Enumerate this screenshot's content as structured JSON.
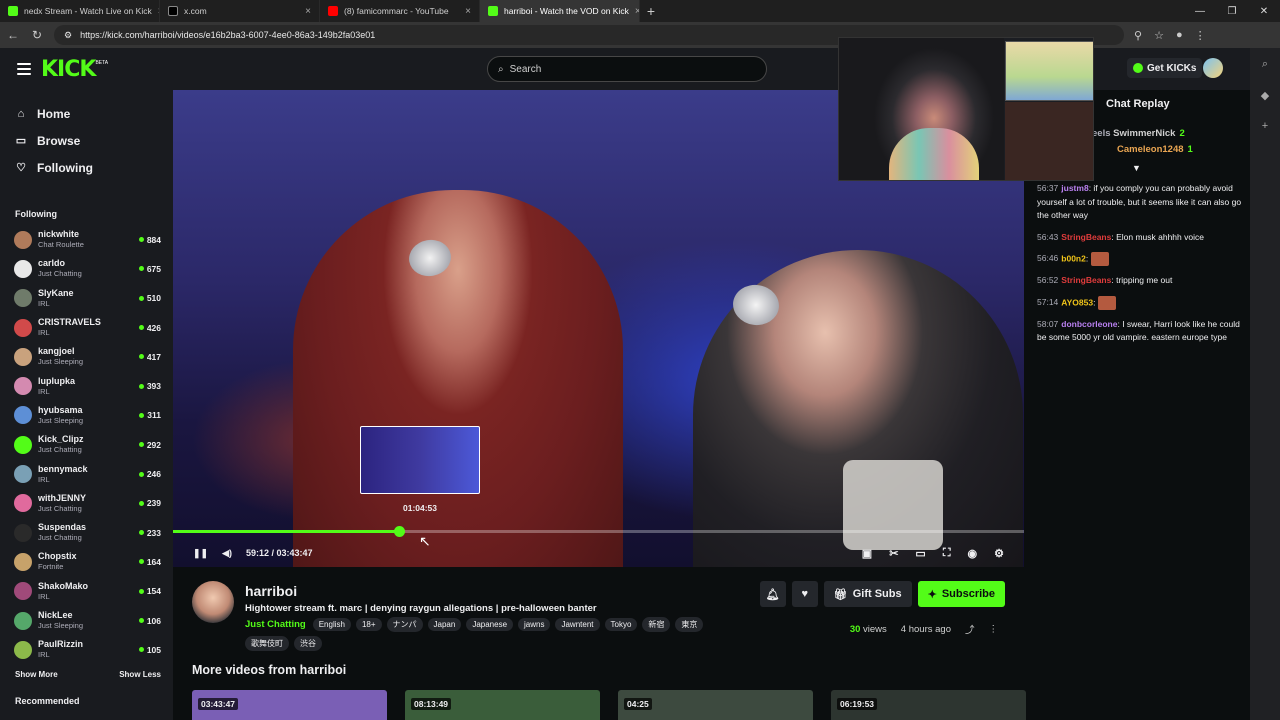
{
  "browser": {
    "tabs": [
      {
        "title": "nedx Stream - Watch Live on Kick",
        "color": "#53fc18",
        "active": false
      },
      {
        "title": "x.com",
        "color": "#ffffff",
        "active": false
      },
      {
        "title": "(8) famicommarc - YouTube",
        "color": "#ff0000",
        "active": false
      },
      {
        "title": "harriboi - Watch the VOD on Kick",
        "color": "#53fc18",
        "active": true
      }
    ],
    "new_tab": "+",
    "url": "https://kick.com/harriboi/videos/e16b2ba3-6007-4ee0-86a3-149b2fa03e01"
  },
  "header": {
    "logo": "KICK",
    "beta": "BETA",
    "search_placeholder": "Search",
    "get_kicks": "Get KICKs"
  },
  "sidebar": {
    "nav": [
      {
        "label": "Home",
        "icon": "home-icon",
        "glyph": "⌂"
      },
      {
        "label": "Browse",
        "icon": "browse-icon",
        "glyph": "▭"
      },
      {
        "label": "Following",
        "icon": "heart-icon",
        "glyph": "♡"
      }
    ],
    "following_title": "Following",
    "channels": [
      {
        "name": "nickwhite",
        "category": "Chat Roulette",
        "viewers": "884",
        "color": "#b07b5b"
      },
      {
        "name": "carldo",
        "category": "Just Chatting",
        "viewers": "675",
        "color": "#e8e8e8"
      },
      {
        "name": "SlyKane",
        "category": "IRL",
        "viewers": "510",
        "color": "#6f7b6a"
      },
      {
        "name": "CRISTRAVELS",
        "category": "IRL",
        "viewers": "426",
        "color": "#d14a4a"
      },
      {
        "name": "kangjoel",
        "category": "Just Sleeping",
        "viewers": "417",
        "color": "#c9a27d"
      },
      {
        "name": "luplupka",
        "category": "IRL",
        "viewers": "393",
        "color": "#d48ab0"
      },
      {
        "name": "hyubsama",
        "category": "Just Sleeping",
        "viewers": "311",
        "color": "#5d8fd6"
      },
      {
        "name": "Kick_Clipz",
        "category": "Just Chatting",
        "viewers": "292",
        "color": "#53fc18"
      },
      {
        "name": "bennymack",
        "category": "IRL",
        "viewers": "246",
        "color": "#7aa0b5"
      },
      {
        "name": "withJENNY",
        "category": "Just Chatting",
        "viewers": "239",
        "color": "#e06a9d"
      },
      {
        "name": "Suspendas",
        "category": "Just Chatting",
        "viewers": "233",
        "color": "#2a2a2a"
      },
      {
        "name": "Chopstix",
        "category": "Fortnite",
        "viewers": "164",
        "color": "#c7a26a"
      },
      {
        "name": "ShakoMako",
        "category": "IRL",
        "viewers": "154",
        "color": "#a04a7a"
      },
      {
        "name": "NickLee",
        "category": "Just Sleeping",
        "viewers": "106",
        "color": "#55a86a"
      },
      {
        "name": "PaulRizzin",
        "category": "IRL",
        "viewers": "105",
        "color": "#8cb94a"
      }
    ],
    "show_more": "Show More",
    "show_less": "Show Less",
    "recommended": "Recommended"
  },
  "player": {
    "hover_time": "01:04:53",
    "time": "59:12 / 03:43:47",
    "progress": 0.266
  },
  "chat": {
    "title": "Chat Replay",
    "gifters": [
      {
        "name": "SwimmerNick",
        "count": "2"
      },
      {
        "name": "Cameleon1248",
        "count": "1"
      }
    ],
    "gifter_prefix": "eels",
    "messages": [
      {
        "time": "56:37",
        "user": "justm8",
        "color": "#b980f0",
        "text": ": if you comply you can probably avoid yourself a lot of trouble, but it seems like it can also go the other way"
      },
      {
        "time": "56:43",
        "user": "StringBeans",
        "color": "#e03c3c",
        "text": ": Elon musk ahhhh voice"
      },
      {
        "time": "56:46",
        "user": "b00n2",
        "color": "#f0c419",
        "text": ":"
      },
      {
        "time": "56:52",
        "user": "StringBeans",
        "color": "#e03c3c",
        "text": ": tripping me out"
      },
      {
        "time": "57:14",
        "user": "AYO853",
        "color": "#f0c419",
        "text": ":"
      },
      {
        "time": "58:07",
        "user": "donbcorleone",
        "color": "#b980f0",
        "text": ": I swear, Harri look like he could be some 5000 yr old vampire. eastern europe type"
      }
    ]
  },
  "video": {
    "channel": "harriboi",
    "title": "Hightower stream ft. marc | denying raygun allegations | pre-halloween banter",
    "category": "Just Chatting",
    "tags": [
      "English",
      "18+",
      "ナンパ",
      "Japan",
      "Japanese",
      "jawns",
      "Jawntent",
      "Tokyo",
      "新宿",
      "東京",
      "歌舞伎町",
      "渋谷"
    ],
    "views_count": "30",
    "views_label": "views",
    "age": "4 hours ago",
    "gift_subs": "Gift Subs",
    "subscribe": "Subscribe",
    "more_title": "More videos from harriboi",
    "more_videos": [
      {
        "duration": "03:43:47",
        "color": "#7a5fb5"
      },
      {
        "duration": "08:13:49",
        "color": "#3a5d3a"
      },
      {
        "duration": "04:25",
        "color": "#3d4a3f"
      },
      {
        "duration": "06:19:53",
        "color": "#2d3530"
      }
    ]
  }
}
